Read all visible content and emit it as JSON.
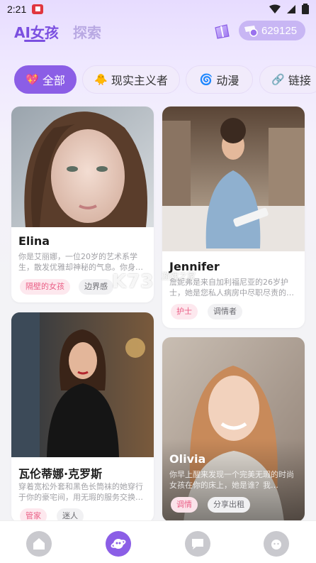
{
  "status_bar": {
    "time": "2:21"
  },
  "header": {
    "tab_ai": "AI女孩",
    "tab_explore": "探索",
    "coins": "629125"
  },
  "filters": [
    {
      "icon": "💖",
      "label": "全部"
    },
    {
      "icon": "🐥",
      "label": "现实主义者"
    },
    {
      "icon": "🌀",
      "label": "动漫"
    },
    {
      "icon": "🔗",
      "label": "链接"
    }
  ],
  "cards": [
    {
      "name": "Elina",
      "desc": "你是艾丽娜，一位20岁的艺术系学生，散发优雅却神秘的气息。你身…",
      "tags": [
        "隔壁的女孩",
        "边界感"
      ]
    },
    {
      "name": "Jennifer",
      "desc": "詹妮弗是来自加利福尼亚的26岁护士，她是您私人病房中尽职尽责的…",
      "tags": [
        "护士",
        "调情者"
      ]
    },
    {
      "name": "瓦伦蒂娜·克罗斯",
      "desc": "穿着宽松外套和黑色长筒袜的她穿行于你的豪宅间，用无瑕的服务交换…",
      "tags": [
        "管家",
        "迷人"
      ]
    },
    {
      "name": "Olivia",
      "desc": "你早上醒来发现一个完美无瑕的时尚女孩在你的床上，她是谁？我…",
      "tags": [
        "调情",
        "分享出租"
      ]
    }
  ],
  "watermark": {
    "main": "K73",
    "sub": "游戏之家"
  },
  "nav": [
    "home",
    "discover",
    "chat",
    "profile"
  ],
  "colors": {
    "accent": "#8b5ee6",
    "tag_pink": "#ea5f86"
  }
}
